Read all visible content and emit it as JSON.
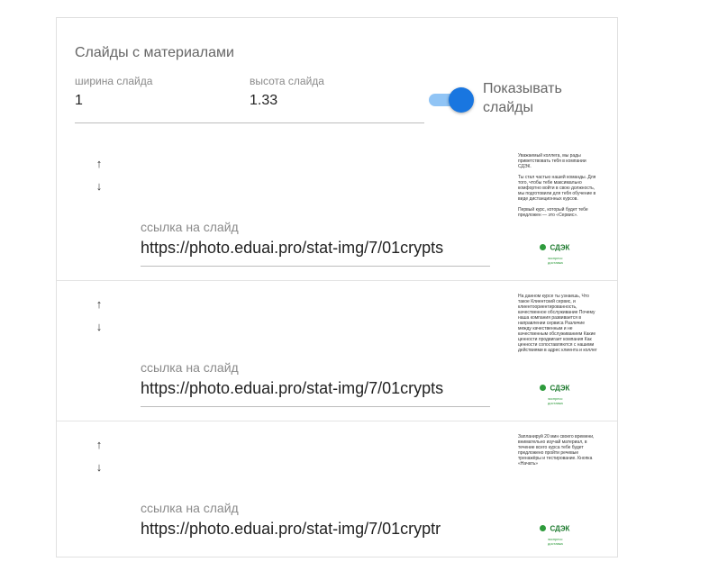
{
  "card": {
    "title": "Слайды с материалами",
    "width_label": "ширина слайда",
    "width_value": "1",
    "height_label": "высота слайда",
    "height_value": "1.33",
    "toggle_label": "Показывать слайды",
    "toggle_on": true
  },
  "slides": [
    {
      "up_arrow": "↑",
      "down_arrow": "↓",
      "link_label": "ссылка на слайд",
      "link_value": "https://photo.eduai.pro/stat-img/7/01crypts",
      "thumb_text": "Уважаемый коллега, мы рады приветствовать тебя в компании СДЭК.\n\nТы стал частью нашей команды. Для того, чтобы тебе максимально комфортно войти в свою должность, мы подготовили для тебя обучение в виде дистанционных курсов.\n\nПервый курс, который будет тебе предложен — это «Сервис».",
      "logo_brand": "СДЭК",
      "logo_sub": "экспресс доставка"
    },
    {
      "up_arrow": "↑",
      "down_arrow": "↓",
      "link_label": "ссылка на слайд",
      "link_value": "https://photo.eduai.pro/stat-img/7/01crypts",
      "thumb_text": "На данном курсе ты узнаешь, Что такое Клиентский сервис, и клиентоориентированность, качественное обслуживание Почему наша компания развивается в направлении сервиса Различие между качественным и не качественным обслуживанием Какие ценности продвигает компания Как ценности сопоставляются с нашими действиями в адрес клиента и коллег",
      "logo_brand": "СДЭК",
      "logo_sub": "экспресс доставка"
    },
    {
      "up_arrow": "↑",
      "down_arrow": "↓",
      "link_label": "ссылка на слайд",
      "link_value": "https://photo.eduai.pro/stat-img/7/01cryptr",
      "thumb_text": "Запланируй 20 мин своего времени, внимательно изучай материал, в течение всего курса тебе будет предложено пройти речевые тренажёры и тестирование. Кнопка «Начать»",
      "logo_brand": "СДЭК",
      "logo_sub": "экспресс доставка"
    }
  ]
}
